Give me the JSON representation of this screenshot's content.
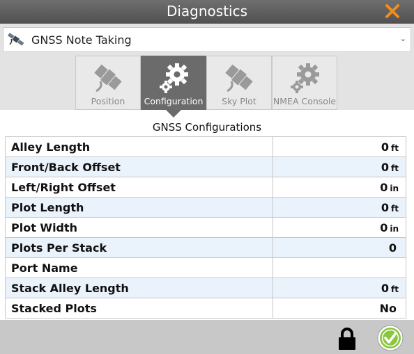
{
  "window": {
    "title": "Diagnostics",
    "close_icon": "close-x-icon",
    "accent_color": "#f28c1e"
  },
  "device_select": {
    "value": "GNSS Note Taking",
    "icon": "satellite-icon"
  },
  "tabs": [
    {
      "label": "Position",
      "icon": "satellite-icon",
      "active": false
    },
    {
      "label": "Configuration",
      "icon": "gears-icon",
      "active": true
    },
    {
      "label": "Sky Plot",
      "icon": "satellite-icon",
      "active": false
    },
    {
      "label": "NMEA Console",
      "icon": "gears-icon",
      "active": false
    }
  ],
  "section": {
    "title": "GNSS Configurations"
  },
  "config_rows": [
    {
      "label": "Alley Length",
      "value": "0",
      "unit": "ft"
    },
    {
      "label": "Front/Back Offset",
      "value": "0",
      "unit": "ft"
    },
    {
      "label": "Left/Right Offset",
      "value": "0",
      "unit": "in"
    },
    {
      "label": "Plot Length",
      "value": "0",
      "unit": "ft"
    },
    {
      "label": "Plot Width",
      "value": "0",
      "unit": "in"
    },
    {
      "label": "Plots Per Stack",
      "value": "0",
      "unit": ""
    },
    {
      "label": "Port Name",
      "value": "",
      "unit": ""
    },
    {
      "label": "Stack Alley Length",
      "value": "0",
      "unit": "ft"
    },
    {
      "label": "Stacked Plots",
      "value": "No",
      "unit": ""
    }
  ],
  "footer": {
    "lock_icon": "lock-icon",
    "ok_icon": "checkmark-circle-icon",
    "ok_color": "#8cc63f"
  }
}
